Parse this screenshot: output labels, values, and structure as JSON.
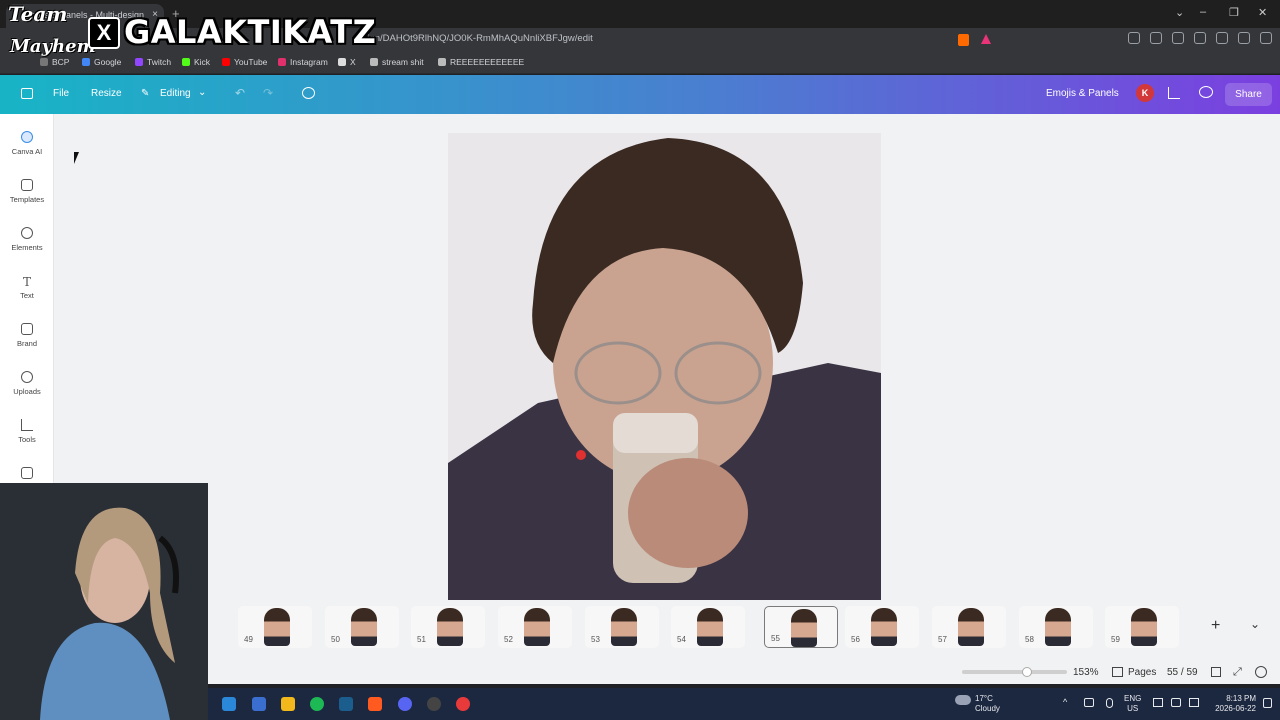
{
  "overlay": {
    "team_line1": "Team",
    "team_line2": "Mayhem",
    "x_glyph": "X",
    "channel": "GALAKTIKATZ"
  },
  "browser": {
    "tab_title": "mojis & Panels - Multi-design",
    "tab_close": "×",
    "new_tab": "+",
    "url": "design/DAHOt9RlhNQ/JO0K-RmMhAQuNnliXBFJgw/edit",
    "window_controls": [
      "⌄",
      "–",
      "❐",
      "✕"
    ],
    "bookmarks": [
      {
        "label": "BCP",
        "color": "#777777"
      },
      {
        "label": "Google",
        "color": "#4285f4"
      },
      {
        "label": "Twitch",
        "color": "#9146ff"
      },
      {
        "label": "Kick",
        "color": "#53fc18"
      },
      {
        "label": "YouTube",
        "color": "#ff0000"
      },
      {
        "label": "Instagram",
        "color": "#e1306c"
      },
      {
        "label": "X",
        "color": "#dddddd"
      },
      {
        "label": "stream shit",
        "color": "#bbbbbb"
      },
      {
        "label": "REEEEEEEEEEEE",
        "color": "#bbbbbb"
      }
    ]
  },
  "header": {
    "file": "File",
    "resize": "Resize",
    "editing": "Editing",
    "project_name": "Emojis & Panels",
    "avatar_initial": "K",
    "share": "Share",
    "accent_start": "#18b4c6",
    "accent_end": "#7b3fe0"
  },
  "sidebar": {
    "items": [
      {
        "label": "Canva AI",
        "icon": "canva-ai-icon"
      },
      {
        "label": "Templates",
        "icon": "templates-icon"
      },
      {
        "label": "Elements",
        "icon": "elements-icon"
      },
      {
        "label": "Text",
        "icon": "text-icon"
      },
      {
        "label": "Brand",
        "icon": "brand-icon"
      },
      {
        "label": "Uploads",
        "icon": "uploads-icon"
      },
      {
        "label": "Tools",
        "icon": "tools-icon"
      },
      {
        "label": "",
        "icon": "projects-icon"
      }
    ]
  },
  "pages": {
    "thumbnails": [
      {
        "num": "49"
      },
      {
        "num": "50"
      },
      {
        "num": "51"
      },
      {
        "num": "52"
      },
      {
        "num": "53"
      },
      {
        "num": "54"
      },
      {
        "num": "55",
        "selected": true
      },
      {
        "num": "56"
      },
      {
        "num": "57"
      },
      {
        "num": "58"
      },
      {
        "num": "59"
      }
    ],
    "add": "+",
    "collapse": "⌄"
  },
  "footer": {
    "zoom": "153%",
    "zoom_level_percent": 62,
    "pages_label": "Pages",
    "page_counter": "55 / 59"
  },
  "taskbar": {
    "weather_temp": "17°C",
    "weather_desc": "Cloudy",
    "lang_line1": "ENG",
    "lang_line2": "US",
    "time": "8:13 PM",
    "date": "2026-06-22",
    "app_colors": [
      "#2b88d8",
      "#3a6fd0",
      "#f2b81c",
      "#1db954",
      "#1b5d8c",
      "#ff5a1f",
      "#5865f2",
      "#444444",
      "#e83a3a"
    ]
  }
}
